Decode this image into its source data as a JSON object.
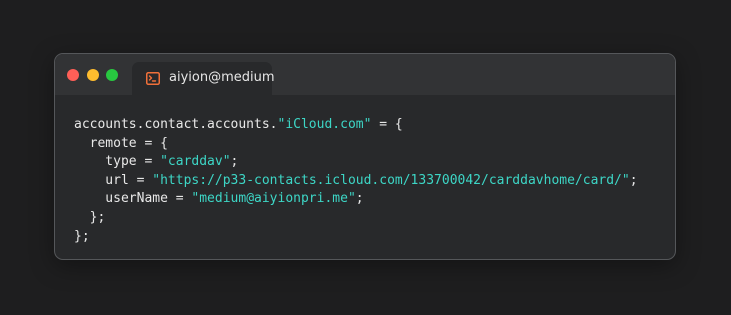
{
  "window": {
    "tab_title": "aiyion@medium",
    "tab_icon": "terminal-icon"
  },
  "colors": {
    "background": "#1e1e1f",
    "window": "#28292b",
    "titlebar": "#323335",
    "close": "#ff5f57",
    "minimize": "#febc2e",
    "maximize": "#28c840",
    "text": "#e8e8e8",
    "string": "#3dd6c6",
    "icon_accent": "#f0703a"
  },
  "code": {
    "lines": [
      [
        {
          "t": "accounts.contact.accounts.",
          "k": "plain"
        },
        {
          "t": "\"iCloud.com\"",
          "k": "string"
        },
        {
          "t": " = {",
          "k": "plain"
        }
      ],
      [
        {
          "t": "  remote = {",
          "k": "plain"
        }
      ],
      [
        {
          "t": "    type = ",
          "k": "plain"
        },
        {
          "t": "\"carddav\"",
          "k": "string"
        },
        {
          "t": ";",
          "k": "plain"
        }
      ],
      [
        {
          "t": "    url = ",
          "k": "plain"
        },
        {
          "t": "\"https://p33-contacts.icloud.com/133700042/carddavhome/card/\"",
          "k": "string"
        },
        {
          "t": ";",
          "k": "plain"
        }
      ],
      [
        {
          "t": "    userName = ",
          "k": "plain"
        },
        {
          "t": "\"medium@aiyionpri.me\"",
          "k": "string"
        },
        {
          "t": ";",
          "k": "plain"
        }
      ],
      [
        {
          "t": "  };",
          "k": "plain"
        }
      ],
      [
        {
          "t": "};",
          "k": "plain"
        }
      ]
    ]
  }
}
